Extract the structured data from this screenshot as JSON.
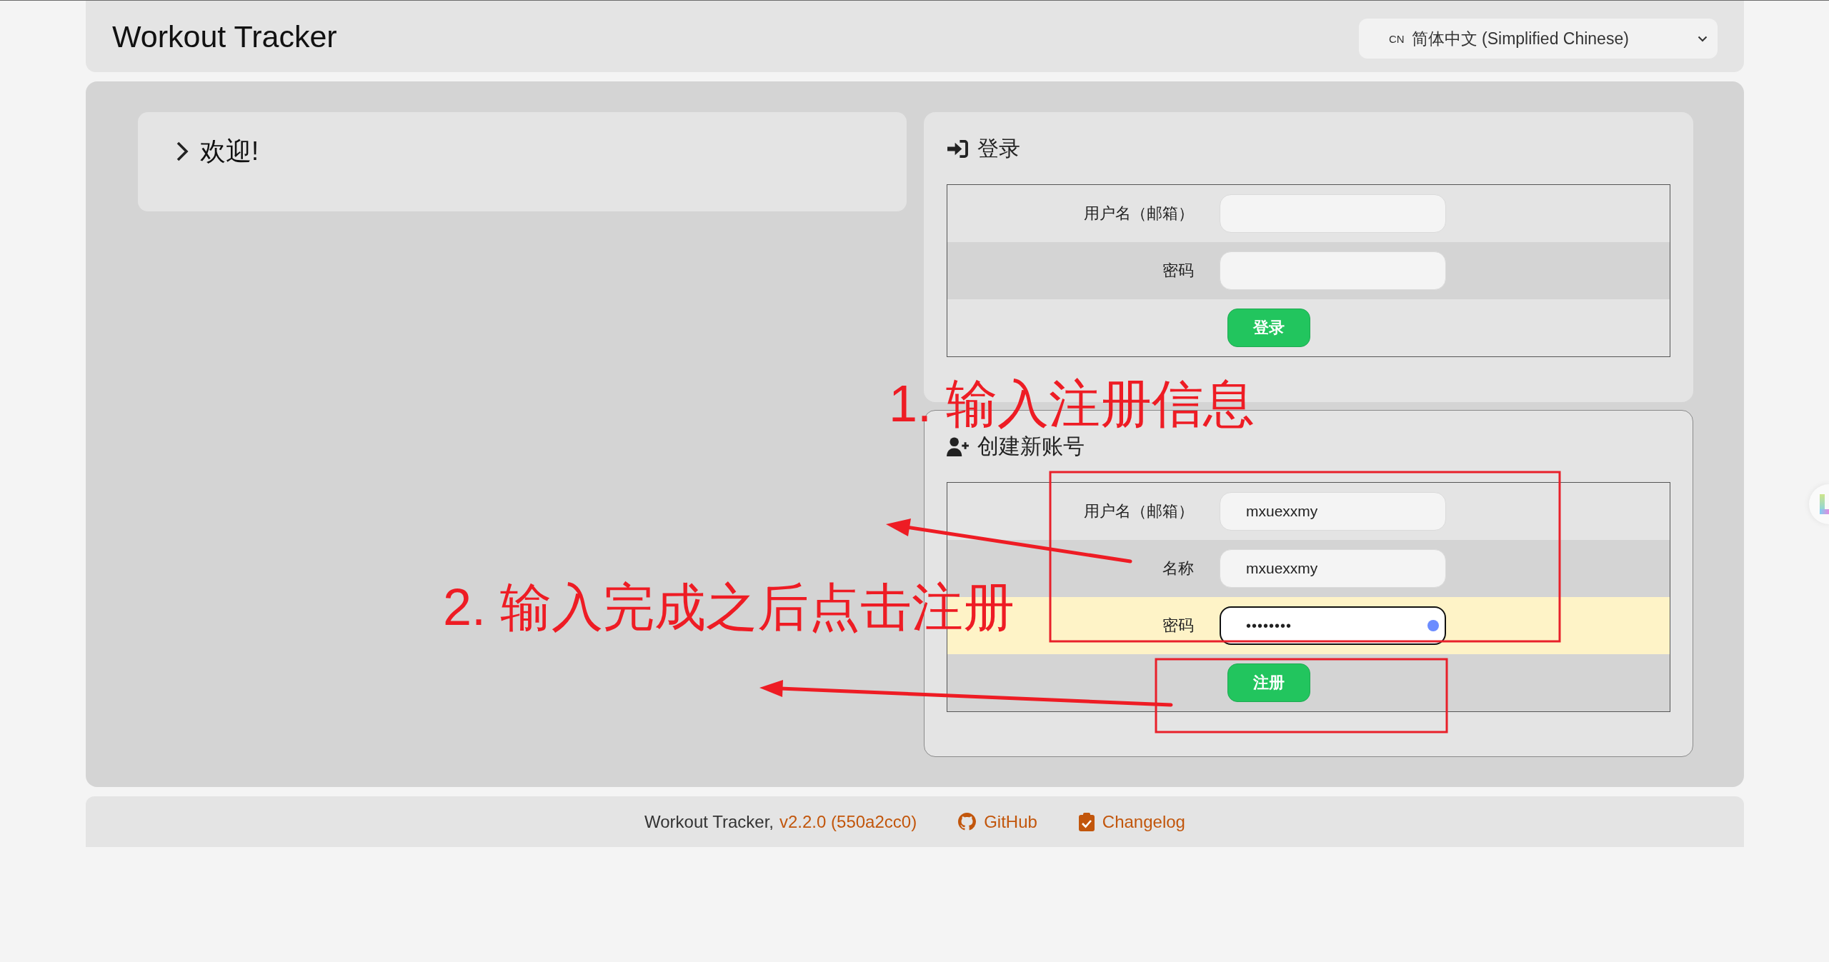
{
  "header": {
    "title": "Workout Tracker",
    "language_select": {
      "flag": "CN",
      "value": "简体中文 (Simplified Chinese)"
    }
  },
  "welcome": {
    "title": "欢迎!"
  },
  "panels": [
    {
      "kind": "login",
      "title": "登录",
      "active": false,
      "fields": [
        {
          "kind": "text",
          "label": "用户名（邮箱）",
          "focused": false
        },
        {
          "kind": "password",
          "label": "密码",
          "focused": false
        }
      ],
      "button": "登录"
    },
    {
      "kind": "register",
      "title": "创建新账号",
      "active": true,
      "fields": [
        {
          "kind": "text",
          "label": "用户名（邮箱）",
          "value": "mxuexxmy",
          "focused": false
        },
        {
          "kind": "text",
          "label": "名称",
          "value": "mxuexxmy",
          "focused": false
        },
        {
          "kind": "password",
          "label": "密码",
          "value": "••••••••",
          "focused": true
        }
      ],
      "button": "注册"
    }
  ],
  "annotations": [
    {
      "text": "1. 输入注册信息"
    },
    {
      "text": "2. 输入完成之后点击注册"
    }
  ],
  "footer": {
    "app_name": "Workout Tracker,",
    "version": "v2.2.0 (550a2cc0)",
    "links": [
      {
        "kind": "github",
        "label": "GitHub"
      },
      {
        "kind": "changelog",
        "label": "Changelog"
      }
    ]
  }
}
